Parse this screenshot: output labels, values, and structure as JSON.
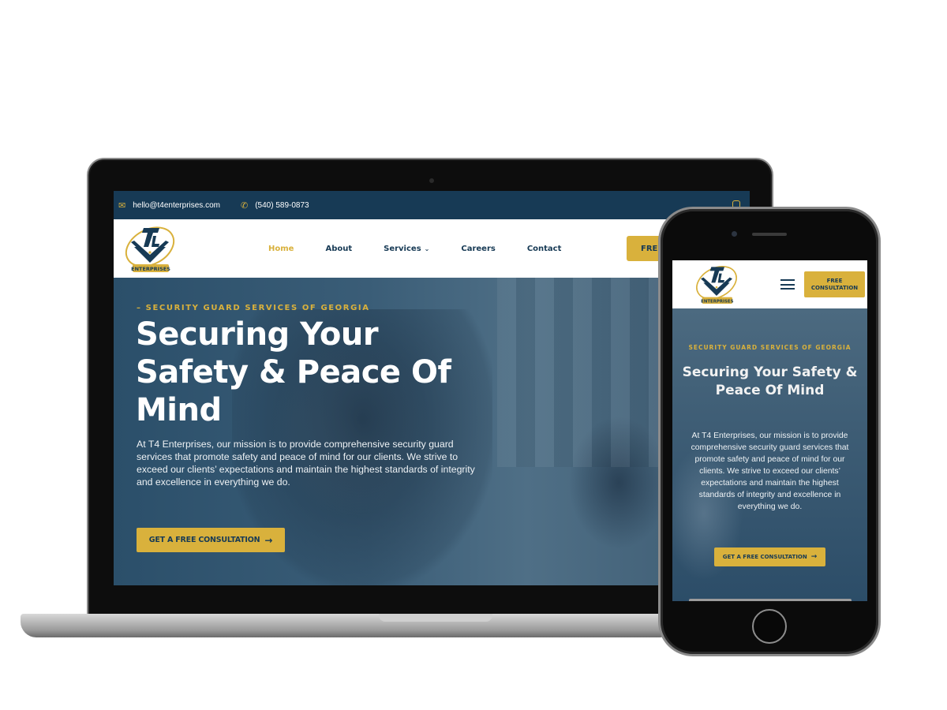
{
  "site": {
    "brand": "T4 Enterprises",
    "logo_text": "ENTERPRISES",
    "colors": {
      "navy": "#173a55",
      "gold": "#d9b13c",
      "white": "#ffffff",
      "grey": "#9c9c9c"
    }
  },
  "topbar": {
    "email": "hello@t4enterprises.com",
    "phone": "(540) 589-0873",
    "email_icon": "mail-icon",
    "phone_icon": "phone-icon",
    "social_icon": "instagram-icon"
  },
  "nav": {
    "items": [
      {
        "label": "Home",
        "active": true
      },
      {
        "label": "About",
        "active": false
      },
      {
        "label": "Services",
        "active": false,
        "has_dropdown": true
      },
      {
        "label": "Careers",
        "active": false
      },
      {
        "label": "Contact",
        "active": false
      }
    ],
    "cta_label": "FREE CONSULTATION",
    "cta_visible_label": "FREE"
  },
  "hero": {
    "eyebrow": "–  SECURITY GUARD SERVICES OF GEORGIA",
    "headline": "Securing Your Safety & Peace Of Mind",
    "body": "At T4 Enterprises, our mission is to provide comprehensive security guard services that promote safety and peace of mind for our clients. We strive to exceed our clients’ expectations and maintain the highest standards of integrity and excellence in everything we do.",
    "cta_label": "GET A FREE CONSULTATION",
    "cta_icon": "arrow-right-icon"
  },
  "mobile": {
    "menu_icon": "hamburger-menu-icon",
    "cta_label_line1": "FREE",
    "cta_label_line2": "CONSULTATION",
    "eyebrow": "SECURITY GUARD SERVICES OF GEORGIA",
    "headline": "Securing Your Safety & Peace Of Mind",
    "body": "At T4 Enterprises, our mission is to provide comprehensive security guard services that promote safety and peace of mind for our clients. We strive to exceed our clients’ expectations and maintain the highest standards of integrity and excellence in everything we do.",
    "cta_label": "GET A FREE CONSULTATION"
  },
  "glyphs": {
    "mail": "✉",
    "phone": "✆",
    "chevron": "⌄",
    "arrow": "→"
  }
}
